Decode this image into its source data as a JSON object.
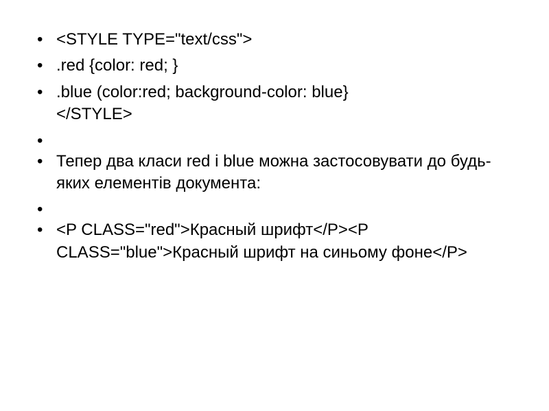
{
  "bullets": [
    {
      "line": "<STYLE TYPE=\"text/css\">"
    },
    {
      "line": ".red {color: red; }"
    },
    {
      "line": ".blue (color:red; background-color: blue}",
      "cont": "</STYLE>"
    },
    {
      "line": ""
    },
    {
      "line": "Тепер два класи red і blue можна застосовувати до будь-яких елементів документа:"
    },
    {
      "line": ""
    },
    {
      "line": "<P CLASS=\"red\">Красный шрифт</P><P CLASS=\"blue\">Красный шрифт на синьому фоне</P>"
    }
  ]
}
